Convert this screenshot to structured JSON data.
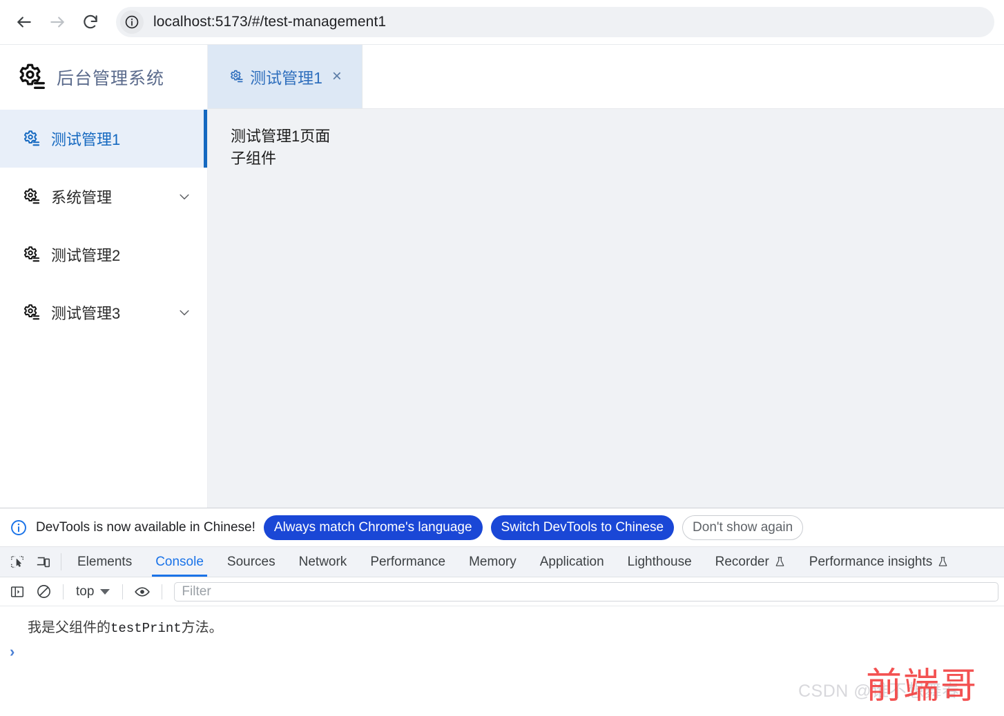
{
  "browser": {
    "back_label": "Back",
    "forward_label": "Forward",
    "reload_label": "Reload",
    "site_info_icon": "info-circle-icon",
    "url": "localhost:5173/#/test-management1"
  },
  "sidebar": {
    "brand": {
      "logo_icon": "gear-settings-icon",
      "title": "后台管理系统"
    },
    "items": [
      {
        "icon": "gear-settings-icon",
        "label": "测试管理1",
        "active": true,
        "chevron": false
      },
      {
        "icon": "gear-settings-icon",
        "label": "系统管理",
        "active": false,
        "chevron": true
      },
      {
        "icon": "gear-settings-icon",
        "label": "测试管理2",
        "active": false,
        "chevron": false
      },
      {
        "icon": "gear-settings-icon",
        "label": "测试管理3",
        "active": false,
        "chevron": true
      }
    ]
  },
  "main": {
    "tabs": [
      {
        "icon": "gear-settings-icon",
        "label": "测试管理1",
        "close": "×",
        "active": true
      }
    ],
    "content": {
      "line1": "测试管理1页面",
      "line2": "子组件"
    }
  },
  "devtools": {
    "banner": {
      "icon": "info-circle-icon",
      "text": "DevTools is now available in Chinese!",
      "buttons": [
        {
          "label": "Always match Chrome's language",
          "style": "primary"
        },
        {
          "label": "Switch DevTools to Chinese",
          "style": "primary"
        },
        {
          "label": "Don't show again",
          "style": "ghost"
        }
      ]
    },
    "left_tools": [
      {
        "icon": "inspect-element-icon"
      },
      {
        "icon": "device-toolbar-icon"
      }
    ],
    "tabs": [
      {
        "label": "Elements",
        "active": false,
        "flask": false
      },
      {
        "label": "Console",
        "active": true,
        "flask": false
      },
      {
        "label": "Sources",
        "active": false,
        "flask": false
      },
      {
        "label": "Network",
        "active": false,
        "flask": false
      },
      {
        "label": "Performance",
        "active": false,
        "flask": false
      },
      {
        "label": "Memory",
        "active": false,
        "flask": false
      },
      {
        "label": "Application",
        "active": false,
        "flask": false
      },
      {
        "label": "Lighthouse",
        "active": false,
        "flask": false
      },
      {
        "label": "Recorder",
        "active": false,
        "flask": true
      },
      {
        "label": "Performance insights",
        "active": false,
        "flask": true
      }
    ],
    "console_toolbar": {
      "sidebar_toggle_icon": "console-sidebar-icon",
      "clear_icon": "clear-console-icon",
      "context_value": "top",
      "eye_icon": "live-expression-icon",
      "filter_placeholder": "Filter",
      "filter_value": ""
    },
    "console": {
      "message_prefix": "我是父组件的",
      "message_mono": "testPrint",
      "message_suffix": "方法。",
      "prompt_caret": "›"
    }
  },
  "watermark": {
    "csdn_text": "CSDN @谁不想舞春",
    "red_text": "前端哥"
  },
  "colors": {
    "accent_blue": "#1468c0",
    "tab_blue": "#2f6fbd",
    "devtools_blue": "#1a73e8",
    "banner_button": "#1a47d6",
    "content_bg": "#f0f2f5",
    "active_menu_bg": "#e8eff9",
    "watermark_red": "#f23a3a"
  }
}
